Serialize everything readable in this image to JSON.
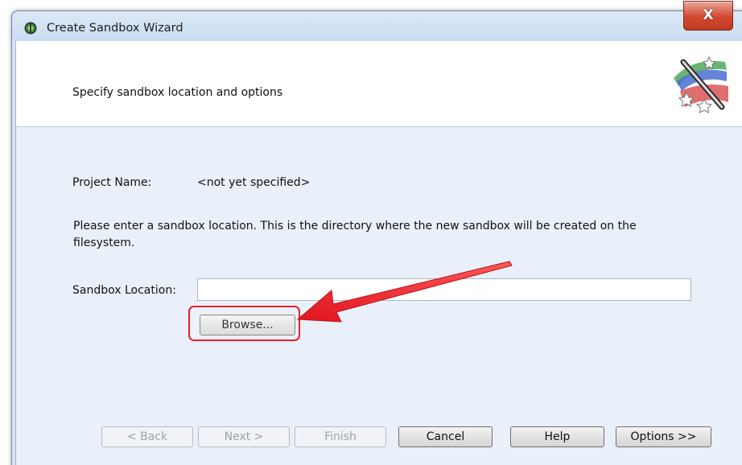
{
  "window": {
    "title": "Create Sandbox Wizard",
    "close_label": "X"
  },
  "header": {
    "text": "Specify sandbox location and options",
    "icon": "magic-wand-stars-icon"
  },
  "project": {
    "label": "Project Name:",
    "value": "<not yet specified>"
  },
  "instructions": "Please enter a sandbox location.  This is the directory where the new sandbox will be created on the filesystem.",
  "location": {
    "label": "Sandbox Location:",
    "value": "",
    "browse_label": "Browse..."
  },
  "buttons": {
    "back": "< Back",
    "next": "Next >",
    "finish": "Finish",
    "cancel": "Cancel",
    "help": "Help",
    "options": "Options >>"
  },
  "colors": {
    "annotation": "#e8202a",
    "close_button": "#d2482f",
    "dialog_background": "#eaf0f9"
  }
}
